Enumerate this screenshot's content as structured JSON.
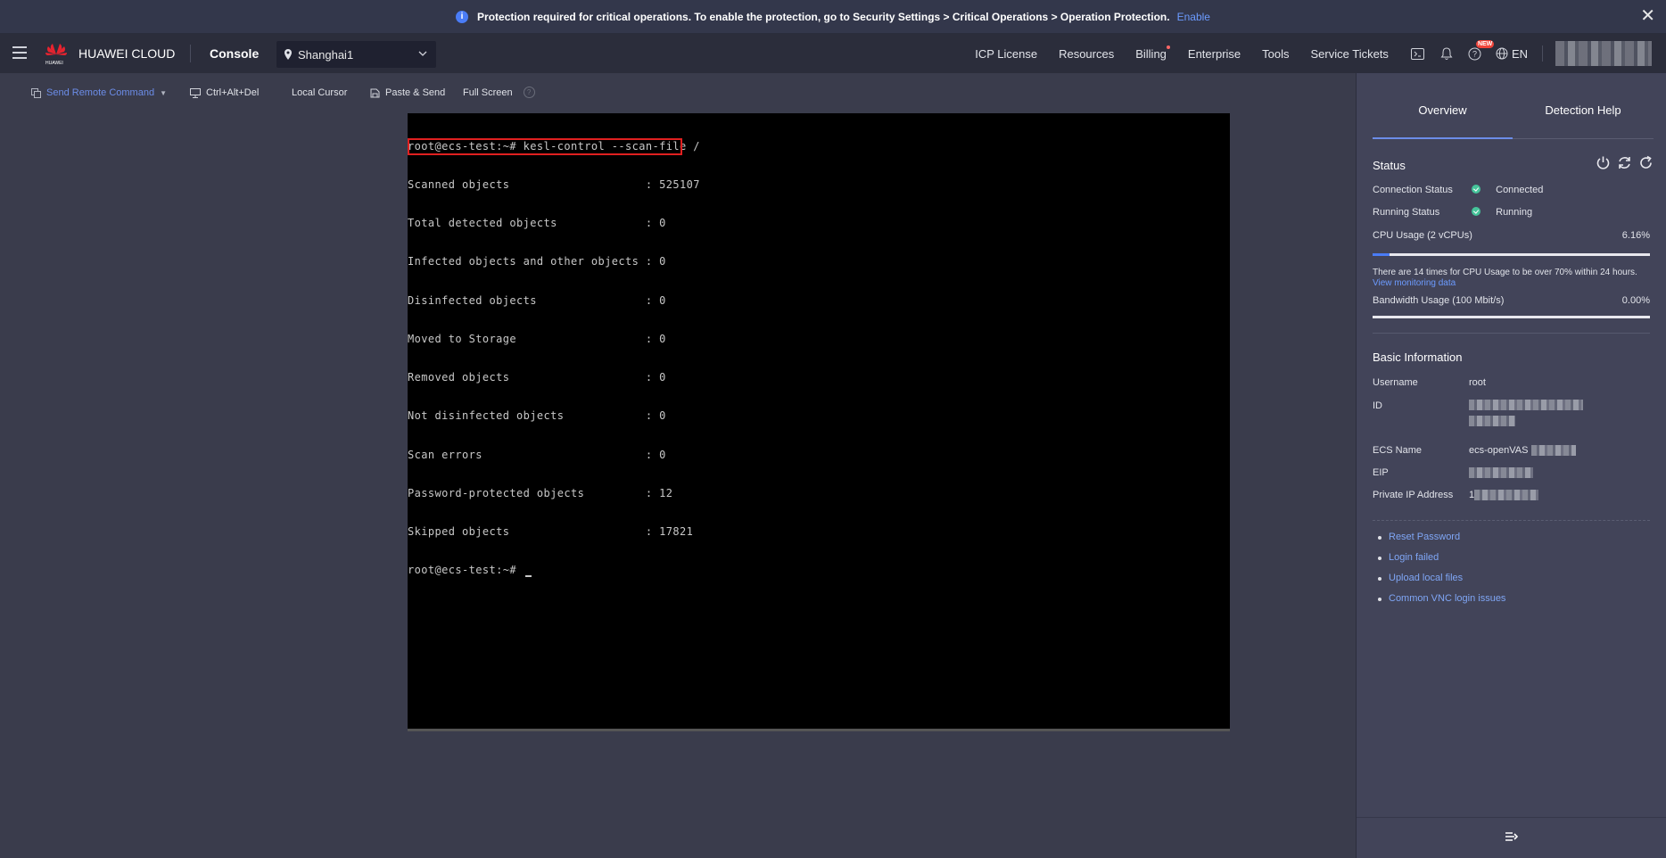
{
  "notice": {
    "text": "Protection required for critical operations. To enable the protection, go to Security Settings > Critical Operations > Operation Protection.",
    "enable_label": "Enable",
    "close_glyph": "✕"
  },
  "header": {
    "brand": "HUAWEI CLOUD",
    "logo_text": "HUAWEI",
    "console_label": "Console",
    "region": "Shanghai1",
    "nav": {
      "icp": "ICP License",
      "resources": "Resources",
      "billing": "Billing",
      "enterprise": "Enterprise",
      "tools": "Tools",
      "tickets": "Service Tickets"
    },
    "new_badge": "NEW",
    "language": "EN"
  },
  "toolbar": {
    "send_command": "Send Remote Command",
    "ctrl_alt_del": "Ctrl+Alt+Del",
    "local_cursor": "Local Cursor",
    "paste_send": "Paste & Send",
    "full_screen": "Full Screen",
    "help_glyph": "?"
  },
  "terminal": {
    "lines": [
      "root@ecs-test:~# kesl-control --scan-file /",
      "Scanned objects                    : 525107",
      "Total detected objects             : 0",
      "Infected objects and other objects : 0",
      "Disinfected objects                : 0",
      "Moved to Storage                   : 0",
      "Removed objects                    : 0",
      "Not disinfected objects            : 0",
      "Scan errors                        : 0",
      "Password-protected objects         : 12",
      "Skipped objects                    : 17821",
      "root@ecs-test:~# "
    ]
  },
  "panel": {
    "tabs": {
      "overview": "Overview",
      "help": "Detection Help"
    },
    "status": {
      "title": "Status",
      "connection_label": "Connection Status",
      "connection_value": "Connected",
      "running_label": "Running Status",
      "running_value": "Running",
      "cpu_label": "CPU Usage (2 vCPUs)",
      "cpu_value": "6.16%",
      "cpu_fraction": 0.0616,
      "cpu_note": "There are 14 times for CPU Usage to be over 70% within 24 hours.",
      "cpu_note_link": "View monitoring data",
      "bandwidth_label": "Bandwidth Usage (100 Mbit/s)",
      "bandwidth_value": "0.00%",
      "bandwidth_fraction": 0.0
    },
    "basic": {
      "title": "Basic Information",
      "username_label": "Username",
      "username_value": "root",
      "id_label": "ID",
      "ecs_label": "ECS Name",
      "ecs_value": "ecs-openVAS",
      "eip_label": "EIP",
      "private_ip_label": "Private IP Address",
      "private_ip_prefix": "1"
    },
    "links": [
      "Reset Password",
      "Login failed",
      "Upload local files",
      "Common VNC login issues"
    ]
  }
}
